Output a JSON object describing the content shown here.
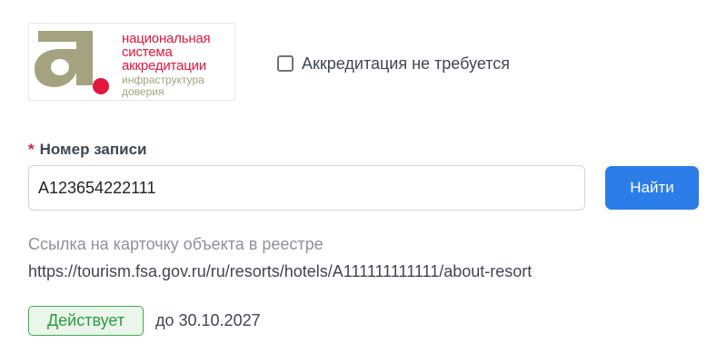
{
  "logo": {
    "line1": "национальная",
    "line2": "система",
    "line3": "аккредитации",
    "sub1": "инфраструктура",
    "sub2": "доверия",
    "colors": {
      "red": "#e3163e",
      "olive": "#a5a27f"
    }
  },
  "accreditation_checkbox": {
    "label": "Аккредитация не требуется",
    "checked": false
  },
  "record_field": {
    "required_mark": "*",
    "label": "Номер записи",
    "value": "A123654222111"
  },
  "find_button": {
    "label": "Найти",
    "color": "#2b7de9"
  },
  "registry": {
    "hint": "Ссылка на карточку объекта в реестре",
    "link": "https://tourism.fsa.gov.ru/ru/resorts/hotels/A111111111111/about-resort"
  },
  "status": {
    "badge": "Действует",
    "until": "до 30.10.2027",
    "color": "#2f9a44"
  }
}
